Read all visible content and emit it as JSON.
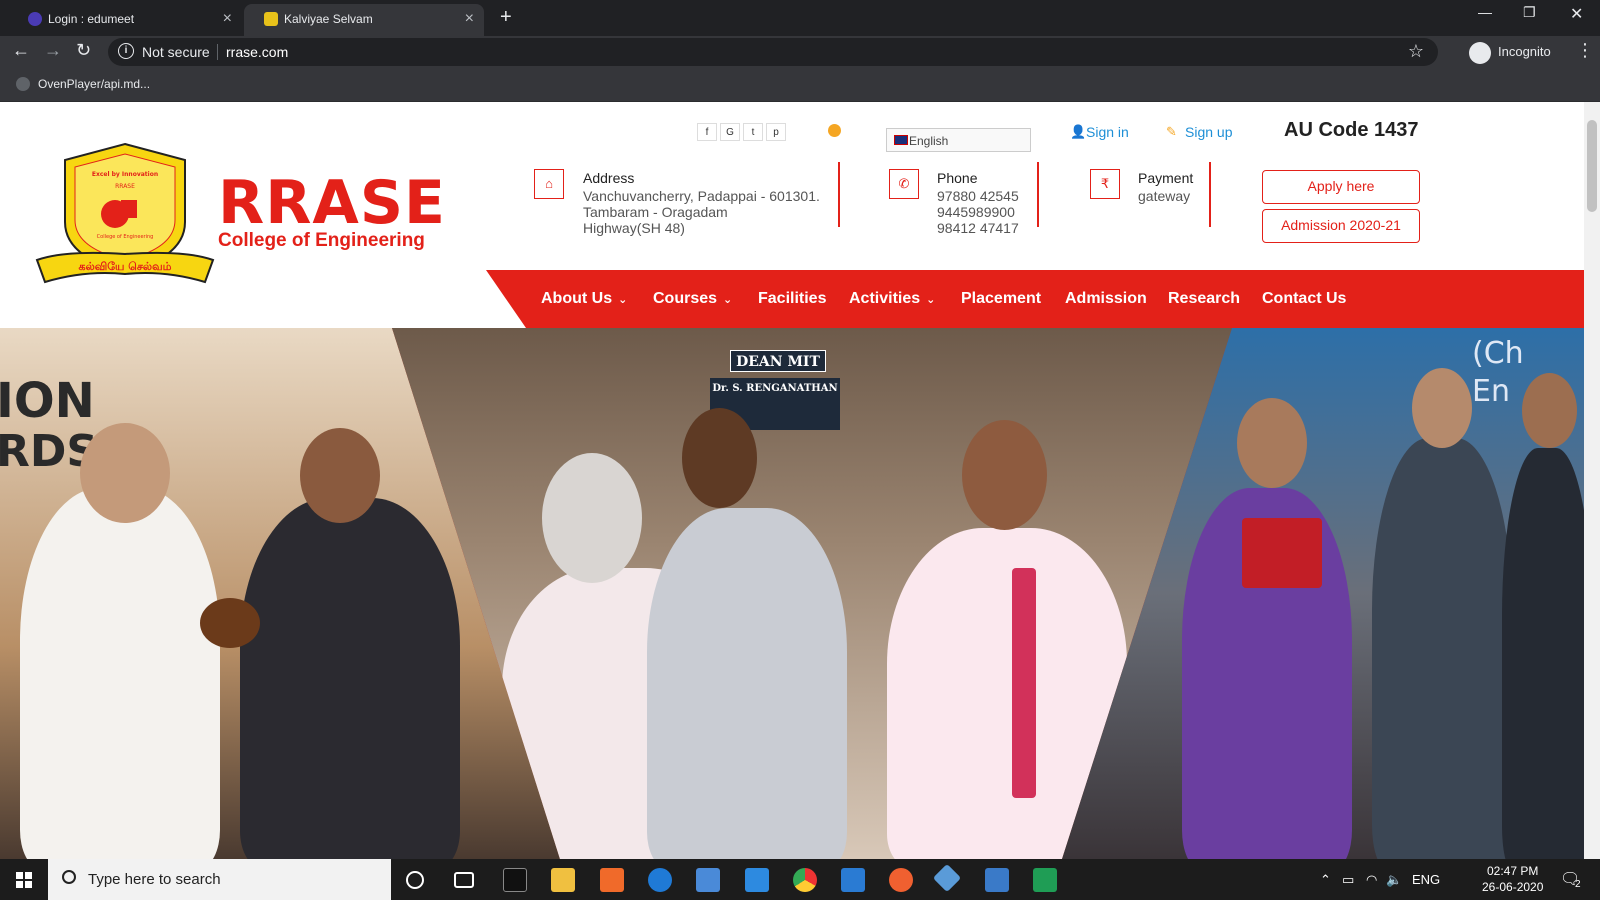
{
  "browser": {
    "tabs": [
      {
        "title": "Login : edumeet",
        "active": false
      },
      {
        "title": "Kalviyae Selvam",
        "active": true
      }
    ],
    "omnibox": {
      "security": "Not secure",
      "url": "rrase.com"
    },
    "profile": "Incognito",
    "bookmark": "OvenPlayer/api.md..."
  },
  "site": {
    "logo": {
      "motto": "Excel by Innovation",
      "org": "RRASE",
      "sub": "College of Engineering",
      "ribbon": "கல்வியே செல்வம்"
    },
    "brand_name": "RRASE",
    "brand_subtitle": "College of Engineering",
    "social": [
      "f",
      "G",
      "t",
      "p"
    ],
    "language": "English",
    "sign_in": "Sign in",
    "sign_up": "Sign up",
    "au_code": "AU Code 1437",
    "address": {
      "title": "Address",
      "lines": [
        "Vanchuvancherry, Padappai - 601301.",
        "Tambaram - Oragadam",
        "Highway(SH 48)"
      ]
    },
    "phone": {
      "title": "Phone",
      "lines": [
        "97880 42545",
        "9445989900",
        "98412 47417"
      ]
    },
    "payment": {
      "title": "Payment",
      "sub": "gateway"
    },
    "apply_label": "Apply here",
    "admission_label": "Admission 2020-21",
    "nav": [
      {
        "label": "About Us",
        "dropdown": true
      },
      {
        "label": "Courses",
        "dropdown": true
      },
      {
        "label": "Facilities",
        "dropdown": false
      },
      {
        "label": "Activities",
        "dropdown": true
      },
      {
        "label": "Placement",
        "dropdown": false
      },
      {
        "label": "Admission",
        "dropdown": false
      },
      {
        "label": "Research",
        "dropdown": false
      },
      {
        "label": "Contact Us",
        "dropdown": false
      }
    ],
    "hero": {
      "left_sign_1": "ION",
      "left_sign_2": "RDS",
      "door_sign_1": "DEAN MIT",
      "door_sign_2": "Dr. S. RENGANATHAN",
      "right_sign_1": "(Ch",
      "right_sign_2": "En"
    }
  },
  "taskbar": {
    "search_placeholder": "Type here to search",
    "lang": "ENG",
    "time": "02:47 PM",
    "date": "26-06-2020",
    "notifications": "2"
  },
  "colors": {
    "brand_red": "#e32119",
    "link_blue": "#1e8fd6"
  }
}
